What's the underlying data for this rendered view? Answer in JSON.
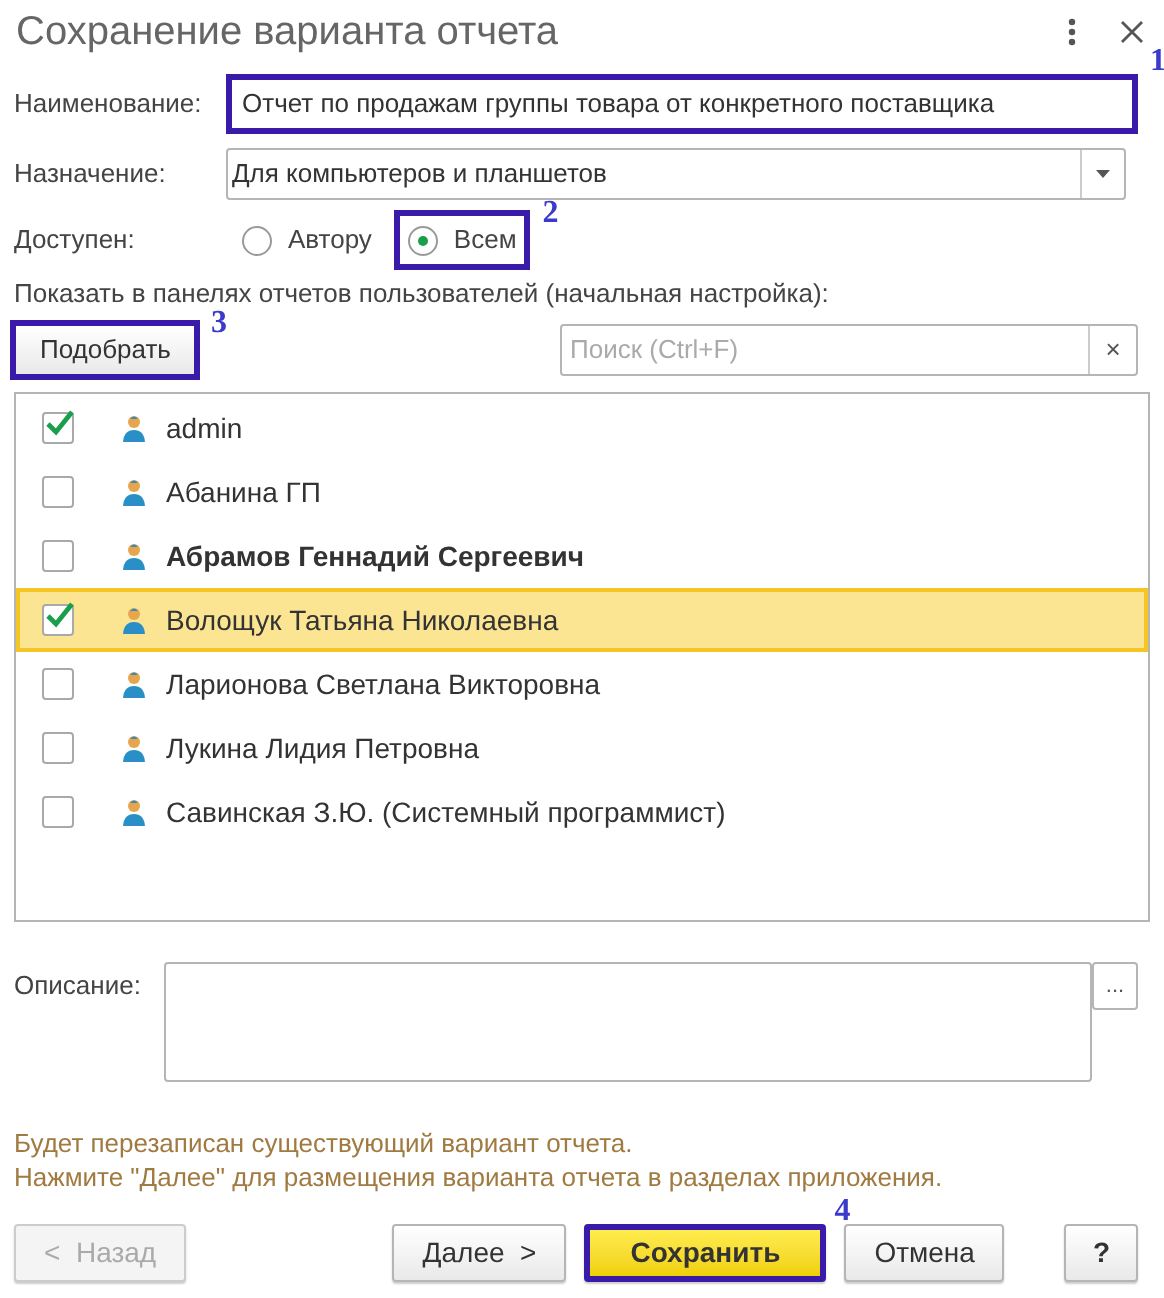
{
  "window": {
    "title": "Сохранение варианта отчета"
  },
  "name_field": {
    "label": "Наименование:",
    "value": "Отчет по продажам группы товара от конкретного поставщика",
    "callout": "1"
  },
  "purpose_field": {
    "label": "Назначение:",
    "value": "Для компьютеров и планшетов"
  },
  "access": {
    "label": "Доступен:",
    "options": [
      {
        "label": "Автору",
        "selected": false
      },
      {
        "label": "Всем",
        "selected": true,
        "callout": "2"
      }
    ]
  },
  "users_section": {
    "label": "Показать в панелях отчетов пользователей (начальная настройка):",
    "pick_button": {
      "label": "Подобрать",
      "callout": "3"
    },
    "search": {
      "placeholder": "Поиск (Ctrl+F)",
      "clear": "×"
    }
  },
  "users": [
    {
      "name": "admin",
      "checked": true,
      "bold": false,
      "selected": false
    },
    {
      "name": "Абанина ГП",
      "checked": false,
      "bold": false,
      "selected": false
    },
    {
      "name": "Абрамов Геннадий Сергеевич",
      "checked": false,
      "bold": true,
      "selected": false
    },
    {
      "name": "Волощук Татьяна Николаевна",
      "checked": true,
      "bold": false,
      "selected": true
    },
    {
      "name": "Ларионова Светлана Викторовна",
      "checked": false,
      "bold": false,
      "selected": false
    },
    {
      "name": "Лукина Лидия Петровна",
      "checked": false,
      "bold": false,
      "selected": false
    },
    {
      "name": "Савинская З.Ю. (Системный программист)",
      "checked": false,
      "bold": false,
      "selected": false
    }
  ],
  "description": {
    "label": "Описание:",
    "button": "..."
  },
  "info": [
    "Будет перезаписан существующий вариант отчета.",
    "Нажмите \"Далее\" для размещения варианта отчета в разделах приложения."
  ],
  "buttons": [
    {
      "label": "<  Назад",
      "kind": "disabled"
    },
    {
      "label": "Далее  >",
      "kind": "normal"
    },
    {
      "label": "Сохранить",
      "kind": "default",
      "callout": "4"
    },
    {
      "label": "Отмена",
      "kind": "normal"
    },
    {
      "label": "?",
      "kind": "help"
    }
  ]
}
